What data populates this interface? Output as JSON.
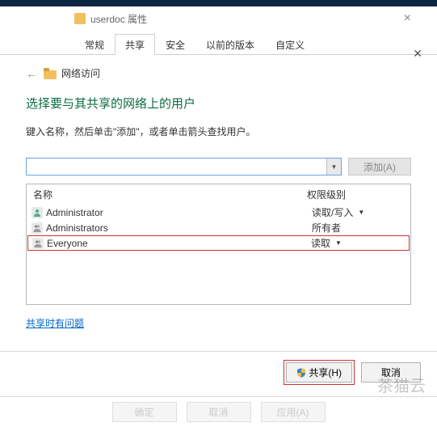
{
  "properties": {
    "title": "userdoc 属性",
    "tabs": [
      "常规",
      "共享",
      "安全",
      "以前的版本",
      "自定义"
    ],
    "active_tab_index": 1
  },
  "dialog": {
    "back_label": "网络访问",
    "heading": "选择要与其共享的网络上的用户",
    "instruction": "键入名称，然后单击\"添加\"，或者单击箭头查找用户。",
    "add_button": "添加(A)",
    "columns": {
      "name": "名称",
      "permission": "权限级别"
    },
    "rows": [
      {
        "name": "Administrator",
        "permission": "读取/写入",
        "has_dropdown": true,
        "icon": "user",
        "highlighted": false
      },
      {
        "name": "Administrators",
        "permission": "所有者",
        "has_dropdown": false,
        "icon": "group",
        "highlighted": false
      },
      {
        "name": "Everyone",
        "permission": "读取",
        "has_dropdown": true,
        "icon": "group",
        "highlighted": true
      }
    ],
    "help_link": "共享时有问题",
    "footer": {
      "share": "共享(H)",
      "cancel": "取消"
    },
    "ghost": {
      "ok": "确定",
      "cancel": "取消",
      "apply": "应用(A)"
    }
  },
  "watermark": "茶猫云"
}
